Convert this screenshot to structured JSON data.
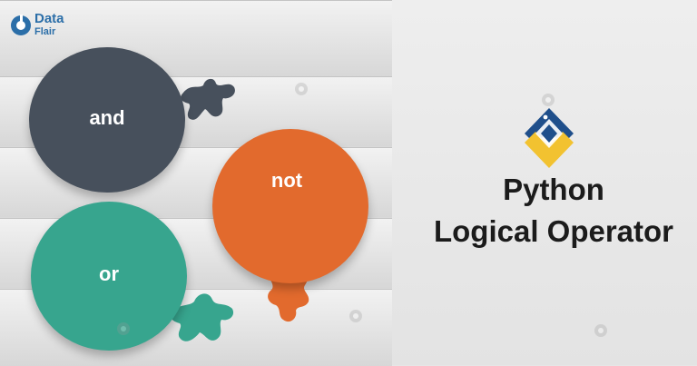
{
  "brand": {
    "line1": "Data",
    "line2": "Flair"
  },
  "operators": {
    "and_label": "and",
    "not_label": "not",
    "or_label": "or"
  },
  "title": {
    "line1": "Python",
    "line2": "Logical Operator"
  },
  "colors": {
    "and": "#47505c",
    "not": "#e26a2d",
    "or": "#37a58e",
    "brand": "#2b6ea8",
    "python_blue": "#1f4f8b",
    "python_yellow": "#f2c230"
  },
  "icons": {
    "brand_logo": "dataflair-logo-icon",
    "python_logo": "python-logo-icon",
    "watermark": "dataflair-watermark-icon"
  }
}
